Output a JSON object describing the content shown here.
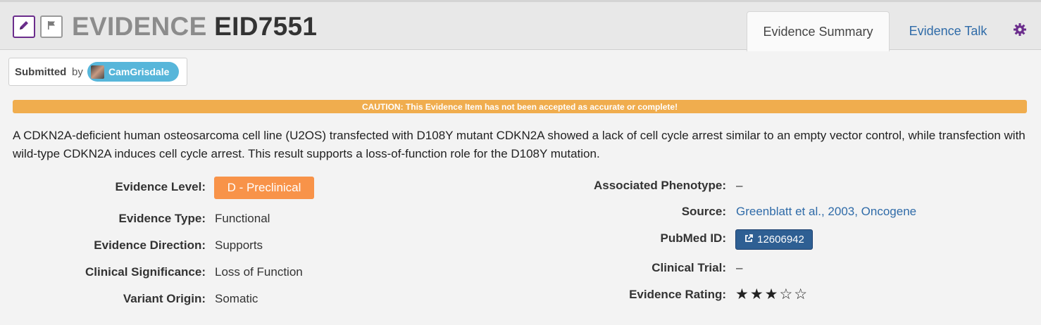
{
  "header": {
    "title_prefix": "EVIDENCE",
    "title_id": "EID7551",
    "edit_icon": "pencil-icon",
    "flag_icon": "flag-icon",
    "tabs": [
      {
        "label": "Evidence Summary",
        "active": true
      },
      {
        "label": "Evidence Talk",
        "active": false
      }
    ],
    "settings_icon": "gear-icon"
  },
  "submitted": {
    "label": "Submitted",
    "by": "by",
    "user": "CamGrisdale"
  },
  "caution": "CAUTION: This Evidence Item has not been accepted as accurate or complete!",
  "description": "A CDKN2A-deficient human osteosarcoma cell line (U2OS) transfected with D108Y mutant CDKN2A showed a lack of cell cycle arrest similar to an empty vector control, while transfection with wild-type CDKN2A induces cell cycle arrest. This result supports a loss-of-function role for the D108Y mutation.",
  "left_fields": {
    "evidence_level": {
      "label": "Evidence Level:",
      "value": "D - Preclinical"
    },
    "evidence_type": {
      "label": "Evidence Type:",
      "value": "Functional"
    },
    "evidence_direction": {
      "label": "Evidence Direction:",
      "value": "Supports"
    },
    "clinical_significance": {
      "label": "Clinical Significance:",
      "value": "Loss of Function"
    },
    "variant_origin": {
      "label": "Variant Origin:",
      "value": "Somatic"
    }
  },
  "right_fields": {
    "associated_phenotype": {
      "label": "Associated Phenotype:",
      "value": "–"
    },
    "source": {
      "label": "Source:",
      "value": "Greenblatt et al., 2003, Oncogene"
    },
    "pubmed_id": {
      "label": "PubMed ID:",
      "value": "12606942",
      "icon": "external-link-icon"
    },
    "clinical_trial": {
      "label": "Clinical Trial:",
      "value": "–"
    },
    "evidence_rating": {
      "label": "Evidence Rating:",
      "stars": "★★★☆☆",
      "rating": 3,
      "max": 5
    }
  },
  "colors": {
    "accent_purple": "#6b2d8c",
    "link_blue": "#2f6ba8",
    "caution_orange": "#f0ad4e",
    "level_orange": "#f89349",
    "pubmed_blue": "#2e5f93",
    "user_pill": "#57b6da"
  }
}
